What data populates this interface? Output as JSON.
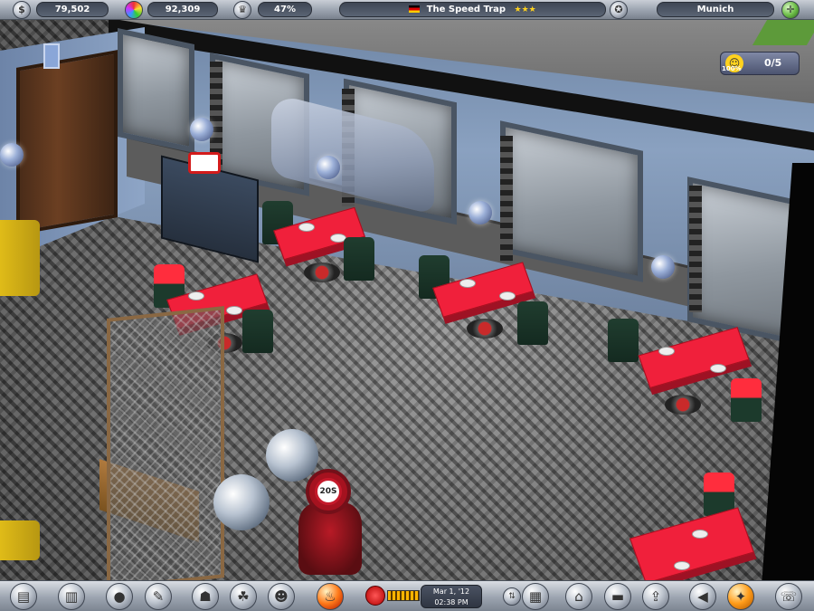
{
  "hud": {
    "money": "79,502",
    "reputation_points": "92,309",
    "popularity": "47%",
    "restaurant_name": "The Speed Trap",
    "restaurant_stars": "★★★",
    "city": "Munich",
    "icons": [
      "coins-icon",
      "color-wheel-icon",
      "trophy-icon",
      "flag-germany-icon",
      "medal-icon",
      "map-icon"
    ]
  },
  "badge": {
    "satisfaction_pct": "100%",
    "guests": "0/5",
    "icon": "smiley-icon"
  },
  "toolbar": {
    "date": "Mar 1, '12",
    "time": "02:38 PM",
    "buttons": [
      "toolbox-icon",
      "stats-chart-icon",
      "food-plate-icon",
      "recipe-scroll-icon",
      "staff-icon",
      "team-icon",
      "guests-icon",
      "flame-marketing-icon",
      "build-crate-icon",
      "shop-icon",
      "construction-icon",
      "export-icon",
      "back-button-icon",
      "compass-icon",
      "phone-icon"
    ]
  },
  "scene": {
    "description_labels": {
      "round_sign": "20S"
    }
  }
}
